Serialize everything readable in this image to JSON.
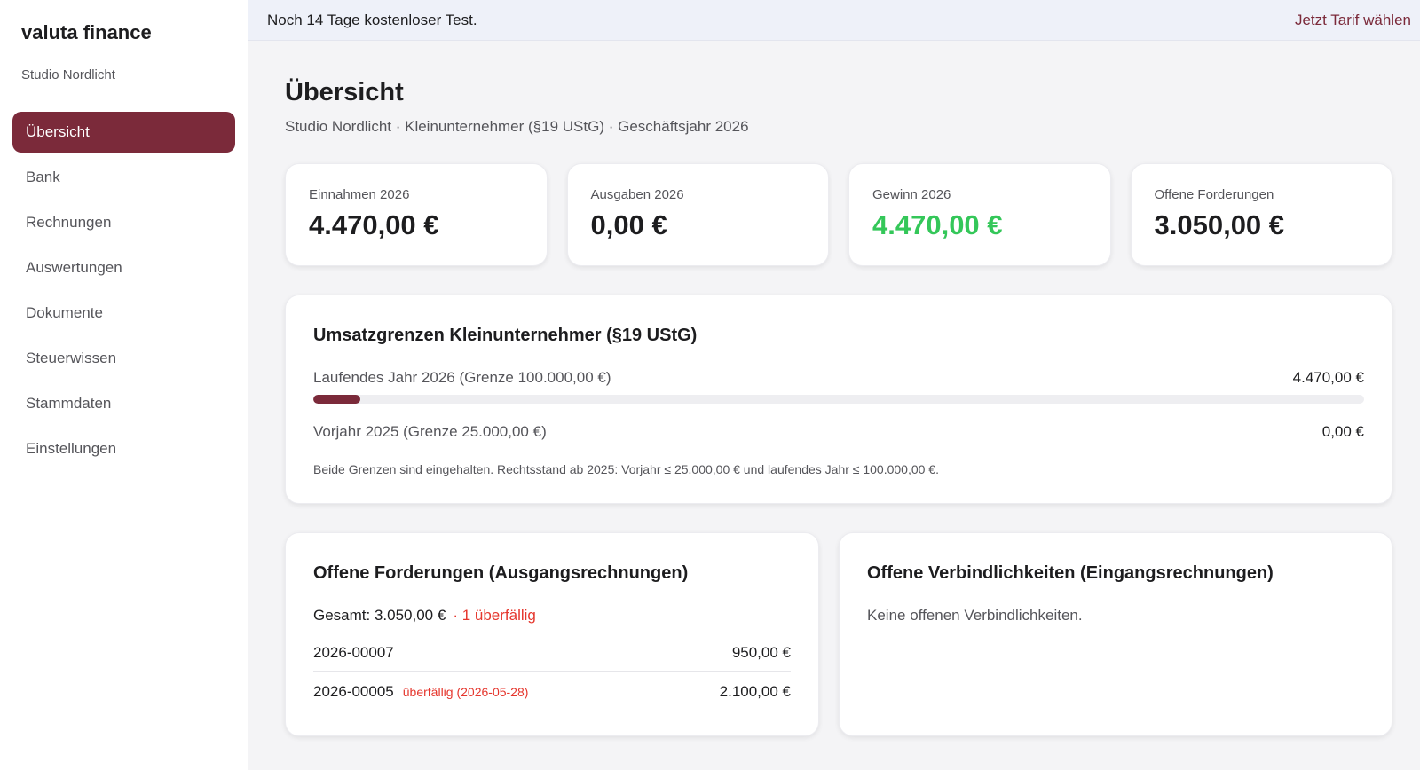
{
  "sidebar": {
    "brand": "valuta finance",
    "org": "Studio Nordlicht",
    "items": [
      {
        "label": "Übersicht",
        "active": true
      },
      {
        "label": "Bank"
      },
      {
        "label": "Rechnungen"
      },
      {
        "label": "Auswertungen"
      },
      {
        "label": "Dokumente"
      },
      {
        "label": "Steuerwissen"
      },
      {
        "label": "Stammdaten"
      },
      {
        "label": "Einstellungen"
      }
    ]
  },
  "trial": {
    "text": "Noch 14 Tage kostenloser Test.",
    "link": "Jetzt Tarif wählen"
  },
  "page": {
    "title": "Übersicht",
    "subtitle": "Studio Nordlicht · Kleinunternehmer (§19 UStG) · Geschäftsjahr 2026"
  },
  "stats": [
    {
      "label": "Einnahmen 2026",
      "value": "4.470,00 €"
    },
    {
      "label": "Ausgaben 2026",
      "value": "0,00 €"
    },
    {
      "label": "Gewinn 2026",
      "value": "4.470,00 €"
    },
    {
      "label": "Offene Forderungen",
      "value": "3.050,00 €"
    }
  ],
  "limits": {
    "title": "Umsatzgrenzen Kleinunternehmer (§19 UStG)",
    "current": {
      "label": "Laufendes Jahr 2026 (Grenze 100.000,00 €)",
      "value": "4.470,00 €",
      "progress": 0.0447
    },
    "previous": {
      "label": "Vorjahr 2025 (Grenze 25.000,00 €)",
      "value": "0,00 €"
    },
    "note": "Beide Grenzen sind eingehalten. Rechtsstand ab 2025: Vorjahr ≤ 25.000,00 € und laufendes Jahr ≤ 100.000,00 €."
  },
  "receivables": {
    "title": "Offene Forderungen (Ausgangsrechnungen)",
    "total": "Gesamt: 3.050,00 €",
    "overdue": "· 1 überfällig",
    "invoices": [
      {
        "number": "2026-00007",
        "tag": "",
        "amount": "950,00 €"
      },
      {
        "number": "2026-00005",
        "tag": "überfällig (2026-05-28)",
        "amount": "2.100,00 €"
      }
    ]
  },
  "payables": {
    "title": "Offene Verbindlichkeiten (Eingangsrechnungen)",
    "empty": "Keine offenen Verbindlichkeiten."
  },
  "colors": {
    "accent": "#7b2a3a",
    "positive": "#34c759",
    "danger": "#e5362d"
  }
}
